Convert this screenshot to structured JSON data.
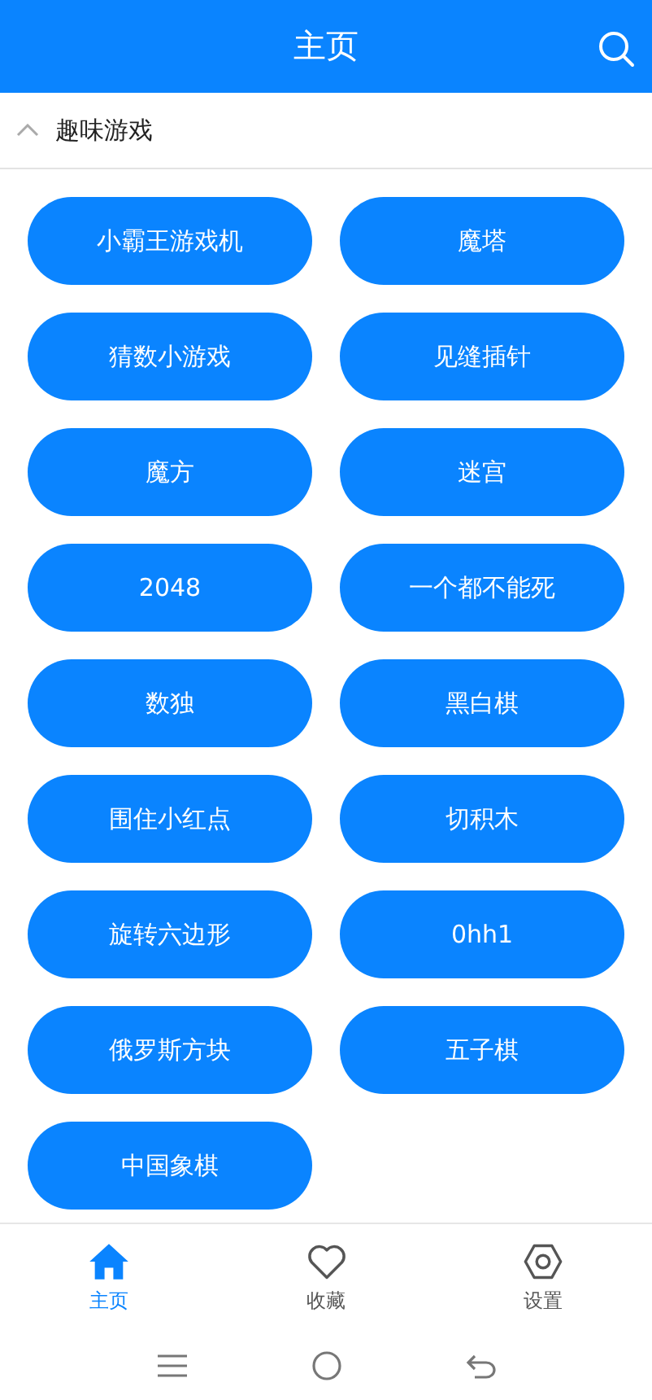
{
  "header": {
    "title": "主页"
  },
  "section": {
    "title": "趣味游戏",
    "expanded": true
  },
  "games": [
    "小霸王游戏机",
    "魔塔",
    "猜数小游戏",
    "见缝插针",
    "魔方",
    "迷宫",
    "2048",
    "一个都不能死",
    "数独",
    "黑白棋",
    "围住小红点",
    "切积木",
    "旋转六边形",
    "0hh1",
    "俄罗斯方块",
    "五子棋",
    "中国象棋"
  ],
  "tabs": [
    {
      "label": "主页",
      "kind": "home",
      "selected": true
    },
    {
      "label": "收藏",
      "kind": "heart",
      "selected": false
    },
    {
      "label": "设置",
      "kind": "gear",
      "selected": false
    }
  ]
}
